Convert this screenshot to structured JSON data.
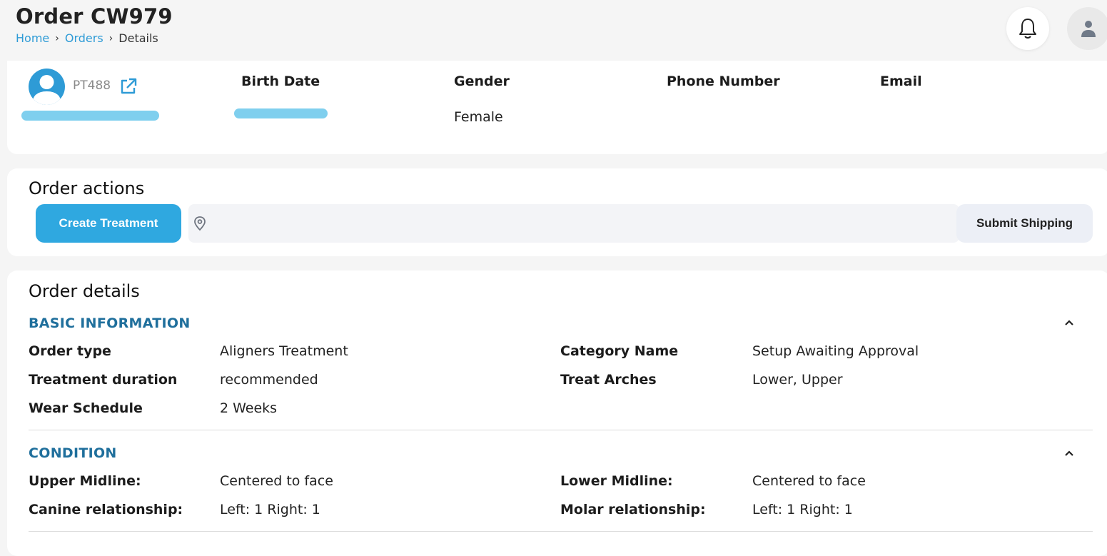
{
  "header": {
    "title": "Order CW979",
    "breadcrumb": {
      "home": "Home",
      "orders": "Orders",
      "current": "Details"
    }
  },
  "icons": {
    "notifications": "bell-icon",
    "account": "user-icon",
    "patient_link": "external-link-icon",
    "location": "map-pin-icon",
    "collapse": "chevron-up-icon"
  },
  "patient": {
    "id": "PT488",
    "columns": {
      "birth_date": "Birth Date",
      "gender": "Gender",
      "phone": "Phone Number",
      "email": "Email"
    },
    "values": {
      "gender": "Female"
    }
  },
  "actions": {
    "title": "Order actions",
    "create_treatment": "Create Treatment",
    "submit_shipping": "Submit Shipping"
  },
  "details": {
    "title": "Order details",
    "basic": {
      "heading": "BASIC INFORMATION",
      "order_type_label": "Order type",
      "order_type_value": "Aligners Treatment",
      "treatment_duration_label": "Treatment duration",
      "treatment_duration_value": "recommended",
      "wear_schedule_label": "Wear Schedule",
      "wear_schedule_value": "2 Weeks",
      "category_label": "Category Name",
      "category_value": "Setup Awaiting Approval",
      "treat_arches_label": "Treat Arches",
      "treat_arches_value": "Lower, Upper"
    },
    "condition": {
      "heading": "CONDITION",
      "upper_midline_label": "Upper Midline:",
      "upper_midline_value": "Centered to face",
      "lower_midline_label": "Lower Midline:",
      "lower_midline_value": "Centered to face",
      "canine_label": "Canine relationship:",
      "canine_value": "Left: 1 Right: 1",
      "molar_label": "Molar relationship:",
      "molar_value": "Left: 1 Right: 1"
    }
  },
  "colors": {
    "accent": "#2fa8e0",
    "link": "#2e9bd6",
    "section_heading": "#1f6f9c",
    "redaction": "#7fcfee"
  }
}
